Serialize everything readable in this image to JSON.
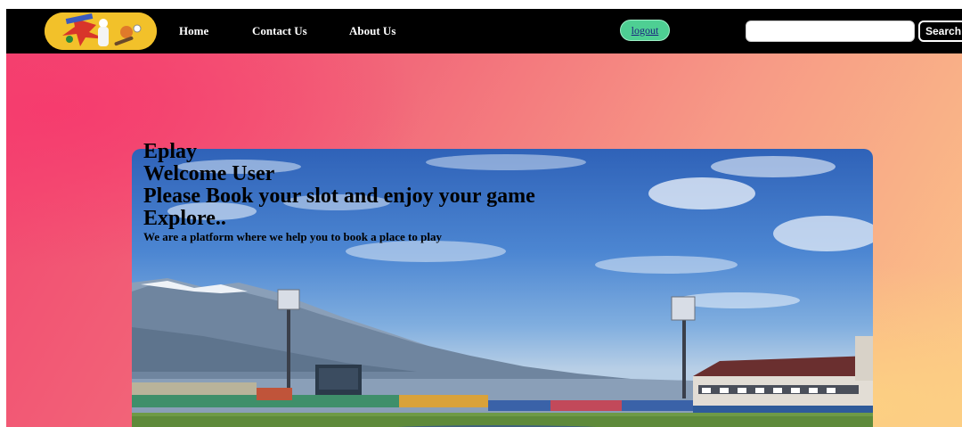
{
  "nav": {
    "logo_icon": "sports-logo-icon",
    "links": [
      "Home",
      "Contact Us",
      "About Us"
    ],
    "logout_label": "logout",
    "search_placeholder": "",
    "search_button_label": "Search"
  },
  "hero": {
    "lines": [
      "Eplay",
      "Welcome User",
      "Please Book your slot and enjoy your game",
      "Explore.."
    ],
    "subtitle": "We are a platform where we help you to book a place to play"
  },
  "colors": {
    "navbar_bg": "#000000",
    "logo_bg": "#f2c12a",
    "logout_bg": "#4ecf93",
    "gradient_start": "#f2466f",
    "gradient_end": "#fbc688"
  }
}
